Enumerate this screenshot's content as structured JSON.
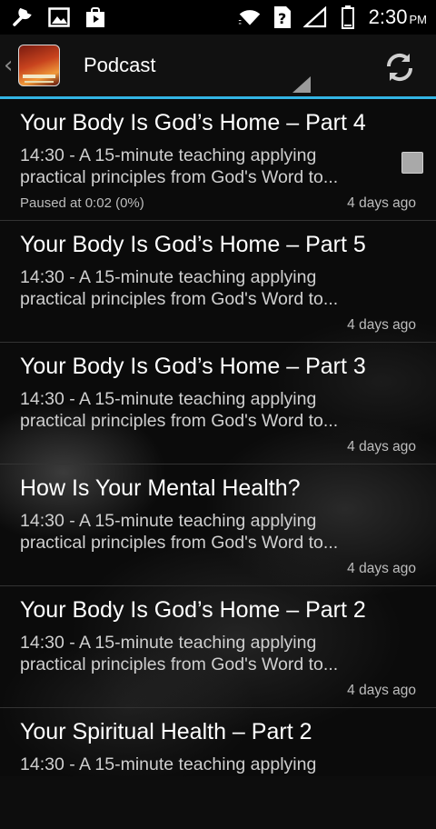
{
  "status_bar": {
    "icons_left": [
      "wrench-icon",
      "image-icon",
      "shopping-bag-icon"
    ],
    "icons_right": [
      "wifi-icon",
      "sim-unknown-icon",
      "signal-icon",
      "battery-icon"
    ],
    "time": "2:30",
    "ampm": "PM"
  },
  "action_bar": {
    "title": "Podcast",
    "accent_color": "#33b5e5",
    "refresh_icon": "refresh-icon"
  },
  "episodes": [
    {
      "title": "Your Body Is God’s Home – Part 4",
      "desc_line1": "14:30 - A 15-minute teaching applying",
      "desc_line2": "practical principles from God's Word to...",
      "status": "Paused at 0:02 (0%)",
      "age": "4 days ago"
    },
    {
      "title": "Your Body Is God’s Home – Part 5",
      "desc_line1": "14:30 - A 15-minute teaching applying",
      "desc_line2": "practical principles from God's Word to...",
      "status": "",
      "age": "4 days ago"
    },
    {
      "title": "Your Body Is God’s Home – Part 3",
      "desc_line1": "14:30 - A 15-minute teaching applying",
      "desc_line2": "practical principles from God's Word to...",
      "status": "",
      "age": "4 days ago"
    },
    {
      "title": "How Is Your Mental Health?",
      "desc_line1": "14:30 - A 15-minute teaching applying",
      "desc_line2": "practical principles from God's Word to...",
      "status": "",
      "age": "4 days ago"
    },
    {
      "title": "Your Body Is God’s Home – Part 2",
      "desc_line1": "14:30 - A 15-minute teaching applying",
      "desc_line2": "practical principles from God's Word to...",
      "status": "",
      "age": "4 days ago"
    },
    {
      "title": "Your Spiritual Health – Part 2",
      "desc_line1": "14:30 - A 15-minute teaching applying",
      "desc_line2": "",
      "status": "",
      "age": ""
    }
  ]
}
